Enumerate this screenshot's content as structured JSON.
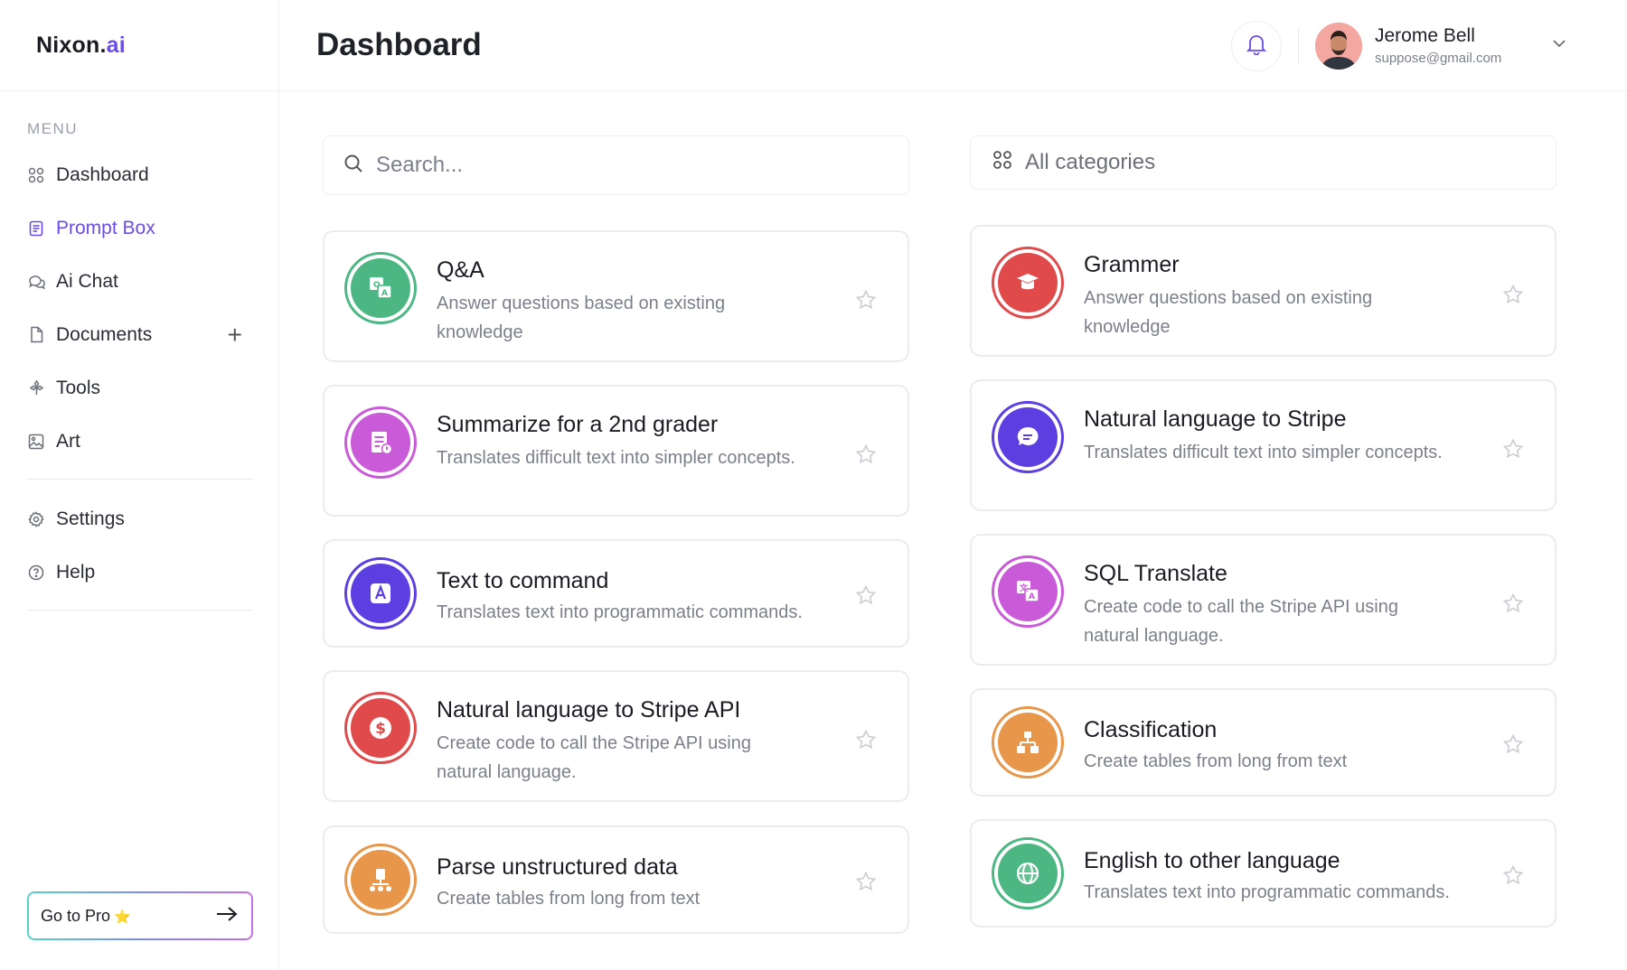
{
  "brand": {
    "name": "Nixon.",
    "accent": "ai"
  },
  "sidebar": {
    "menu_label": "MENU",
    "items": [
      {
        "label": "Dashboard",
        "icon": "grid-icon"
      },
      {
        "label": "Prompt Box",
        "icon": "document-list-icon",
        "active": true
      },
      {
        "label": "Ai Chat",
        "icon": "chat-icon"
      },
      {
        "label": "Documents",
        "icon": "file-icon"
      },
      {
        "label": "Tools",
        "icon": "tools-icon"
      },
      {
        "label": "Art",
        "icon": "image-icon"
      }
    ],
    "bottom_items": [
      {
        "label": "Settings",
        "icon": "gear-icon"
      },
      {
        "label": "Help",
        "icon": "help-icon"
      }
    ],
    "go_pro": "Go to Pro",
    "go_pro_star": "⭐"
  },
  "header": {
    "title": "Dashboard",
    "user": {
      "name": "Jerome Bell",
      "email": "suppose@gmail.com"
    }
  },
  "search": {
    "placeholder": "Search..."
  },
  "categories": {
    "label": "All categories"
  },
  "cards": [
    {
      "title": "Q&A",
      "desc": "Answer questions based on existing knowledge",
      "color": "#4cb782",
      "icon": "translate-icon"
    },
    {
      "title": "Summarize for a 2nd grader",
      "desc": "Translates difficult text into simpler concepts.",
      "color": "#c95bd8",
      "icon": "summary-icon"
    },
    {
      "title": "Text to command",
      "desc": "Translates text into programmatic commands.",
      "color": "#5b3fe0",
      "icon": "letter-a-icon"
    },
    {
      "title": "Natural language to Stripe API",
      "desc": "Create code to call the Stripe API using natural language.",
      "color": "#e04a4a",
      "icon": "dollar-icon"
    },
    {
      "title": "Parse unstructured data",
      "desc": "Create tables from long from text",
      "color": "#e8964a",
      "icon": "hierarchy-icon"
    },
    {
      "title": "Grammer",
      "desc": "Answer questions based on existing knowledge",
      "color": "#e04a4a",
      "icon": "graduation-icon"
    },
    {
      "title": "Natural language to Stripe",
      "desc": "Translates difficult text into simpler concepts.",
      "color": "#5b3fe0",
      "icon": "message-icon"
    },
    {
      "title": "SQL Translate",
      "desc": "Create code to call the Stripe API using natural language.",
      "color": "#c95bd8",
      "icon": "translate-icon"
    },
    {
      "title": "Classification",
      "desc": "Create tables from long from text",
      "color": "#e8964a",
      "icon": "org-chart-icon"
    },
    {
      "title": "English to other language",
      "desc": "Translates text into programmatic commands.",
      "color": "#4cb782",
      "icon": "globe-icon"
    }
  ]
}
